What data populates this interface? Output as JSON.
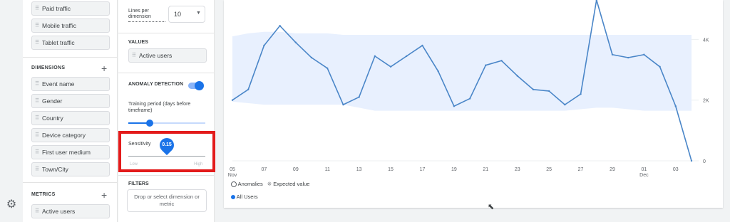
{
  "variables_panel": {
    "segments": [
      "Paid traffic",
      "Mobile traffic",
      "Tablet traffic"
    ],
    "dimensions_title": "DIMENSIONS",
    "dimensions": [
      "Event name",
      "Gender",
      "Country",
      "Device category",
      "First user medium",
      "Town/City"
    ],
    "metrics_title": "METRICS",
    "metrics": [
      "Active users"
    ]
  },
  "settings_panel": {
    "lines_label": "Lines per dimension",
    "lines_value": "10",
    "values_title": "VALUES",
    "values_chip": "Active users",
    "anomaly_title": "ANOMALY DETECTION",
    "anomaly_enabled": true,
    "training_label": "Training period (days before timeframe)",
    "training_value_fraction": 0.28,
    "sensitivity_label": "Sensitivity",
    "sensitivity_value": "0.15",
    "sensitivity_value_fraction": 0.5,
    "sensitivity_low": "Low",
    "sensitivity_high": "High",
    "filters_title": "FILTERS",
    "filters_placeholder": "Drop or select dimension or metric"
  },
  "legend": {
    "anomalies": "Anomalies",
    "expected": "Expected value",
    "series": "All Users"
  },
  "icons": {
    "settings": "gear-icon",
    "dropdown": "chevron-down-icon"
  },
  "colors": {
    "line": "#4a86c8",
    "band": "#e8f0fe",
    "accent": "#1a73e8",
    "highlight": "#e31b1b"
  },
  "chart_data": {
    "type": "line",
    "x_tick_labels": [
      "05",
      "07",
      "09",
      "11",
      "13",
      "15",
      "17",
      "19",
      "21",
      "23",
      "25",
      "27",
      "29",
      "01",
      "03"
    ],
    "x_month_labels": [
      "Nov",
      "Dec"
    ],
    "y_tick_labels": [
      "0",
      "2K",
      "4K"
    ],
    "ylim": [
      0,
      5300
    ],
    "x": [
      "Nov 05",
      "Nov 06",
      "Nov 07",
      "Nov 08",
      "Nov 09",
      "Nov 10",
      "Nov 11",
      "Nov 12",
      "Nov 13",
      "Nov 14",
      "Nov 15",
      "Nov 16",
      "Nov 17",
      "Nov 18",
      "Nov 19",
      "Nov 20",
      "Nov 21",
      "Nov 22",
      "Nov 23",
      "Nov 24",
      "Nov 25",
      "Nov 26",
      "Nov 27",
      "Nov 28",
      "Nov 29",
      "Nov 30",
      "Dec 01",
      "Dec 02",
      "Dec 03",
      "Dec 04"
    ],
    "series": [
      {
        "name": "All Users",
        "values": [
          2000,
          2350,
          3800,
          4450,
          3900,
          3400,
          3050,
          1850,
          2100,
          3450,
          3100,
          3450,
          3800,
          2950,
          1800,
          2050,
          3150,
          3300,
          2800,
          2350,
          2300,
          1850,
          2200,
          5300,
          3500,
          3400,
          3500,
          3100,
          1800,
          0
        ]
      }
    ],
    "expected_band": {
      "upper": [
        4100,
        4200,
        4250,
        4250,
        4200,
        4200,
        4200,
        4150,
        4150,
        4150,
        4150,
        4150,
        4150,
        4150,
        4150,
        4150,
        4150,
        4150,
        4150,
        4150,
        4150,
        4150,
        4150,
        4150,
        4150,
        4150,
        4150,
        4150,
        4150,
        4150
      ],
      "lower": [
        1950,
        1900,
        1850,
        1850,
        1850,
        1850,
        1850,
        1850,
        1750,
        1650,
        1650,
        1650,
        1650,
        1650,
        1650,
        1650,
        1650,
        1650,
        1650,
        1650,
        1650,
        1650,
        1700,
        1750,
        1750,
        1700,
        1650,
        1650,
        1650,
        1650
      ]
    },
    "grid": true
  }
}
